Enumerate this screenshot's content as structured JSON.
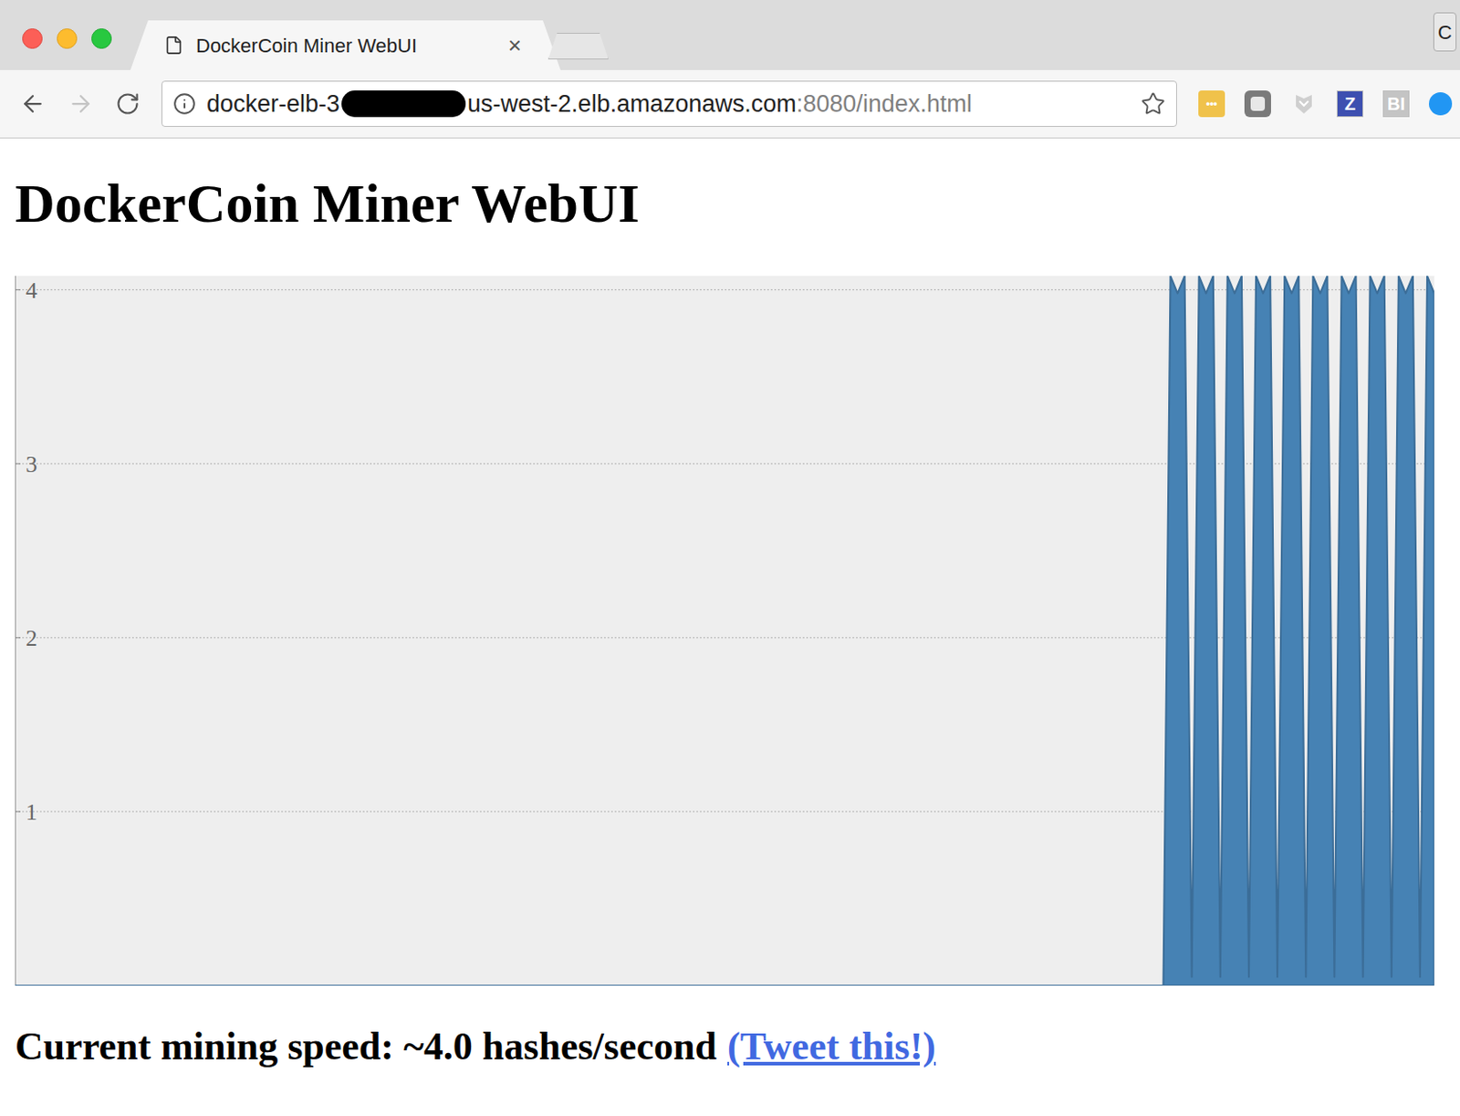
{
  "tab": {
    "title": "DockerCoin Miner WebUI",
    "close": "×",
    "selected": true
  },
  "profile_button": "C",
  "address_bar": {
    "url_start": "docker-elb-3",
    "url_end": "us-west-2.elb.amazonaws.com",
    "url_path": ":8080/index.html",
    "bookmarked": false
  },
  "extensions": [
    {
      "kind": "dots",
      "label": "•••",
      "color": "#f0c24b"
    },
    {
      "kind": "square",
      "color": "#7a7a7a"
    },
    {
      "kind": "shield",
      "color": "#cfcfcf"
    },
    {
      "kind": "letter",
      "label": "Z",
      "color": "#3d4fb0"
    },
    {
      "kind": "letter",
      "label": "BI",
      "color": "#c4c4c4"
    },
    {
      "kind": "circle",
      "color": "#2196f3"
    }
  ],
  "page": {
    "heading": "DockerCoin Miner WebUI",
    "chart": {
      "y_ticks": [
        "1",
        "2",
        "3",
        "4"
      ],
      "series": [
        {
          "color": "#4682b4",
          "values": [
            0,
            0,
            0,
            0,
            0,
            0,
            0,
            0,
            0,
            0,
            0,
            0,
            0,
            0,
            0,
            0,
            0,
            0,
            0,
            0,
            0,
            0,
            0,
            0,
            0,
            0,
            0,
            0,
            0,
            0,
            0,
            0,
            0,
            0,
            0,
            0,
            0,
            0,
            0,
            0,
            0,
            0,
            0,
            0,
            0,
            0,
            0,
            0,
            0,
            0,
            0,
            0,
            0,
            0,
            0,
            0,
            0,
            0,
            0,
            0,
            0,
            0,
            0,
            0,
            0,
            0,
            0,
            0,
            0,
            0,
            0,
            0,
            0,
            0,
            0,
            0,
            0,
            0,
            0,
            0,
            0,
            0,
            0,
            0,
            0,
            0,
            0,
            0,
            0,
            0,
            0,
            0,
            0,
            0,
            0,
            0,
            0,
            0,
            0,
            0,
            0,
            0,
            0,
            0,
            0,
            0,
            0,
            0,
            0,
            0,
            0,
            0,
            0,
            0,
            0,
            0,
            0,
            0,
            0,
            0,
            0,
            0,
            0,
            0,
            0,
            0,
            0,
            0,
            0,
            0,
            0,
            0,
            0,
            0,
            0,
            0,
            0,
            0,
            0,
            0,
            0,
            0,
            0,
            0,
            0,
            0,
            0,
            0,
            0,
            0,
            0,
            0,
            0,
            0,
            0,
            0,
            0,
            0,
            0,
            0,
            0,
            0,
            4.08,
            3.98,
            4.08,
            0.05,
            4.08,
            3.98,
            4.08,
            0.05,
            4.08,
            3.98,
            4.08,
            0.05,
            4.08,
            3.98,
            4.08,
            0.05,
            4.08,
            3.98,
            4.08,
            0.05,
            4.08,
            3.98,
            4.08,
            0.05,
            4.08,
            3.98,
            4.08,
            0.05,
            4.08,
            3.98,
            4.08,
            0.05,
            4.08,
            3.98,
            4.08,
            0.05,
            4.08,
            3.98
          ]
        }
      ]
    },
    "speed_label": "Current mining speed: ~4.0 hashes/second",
    "tweet_link": "(Tweet this!)"
  }
}
